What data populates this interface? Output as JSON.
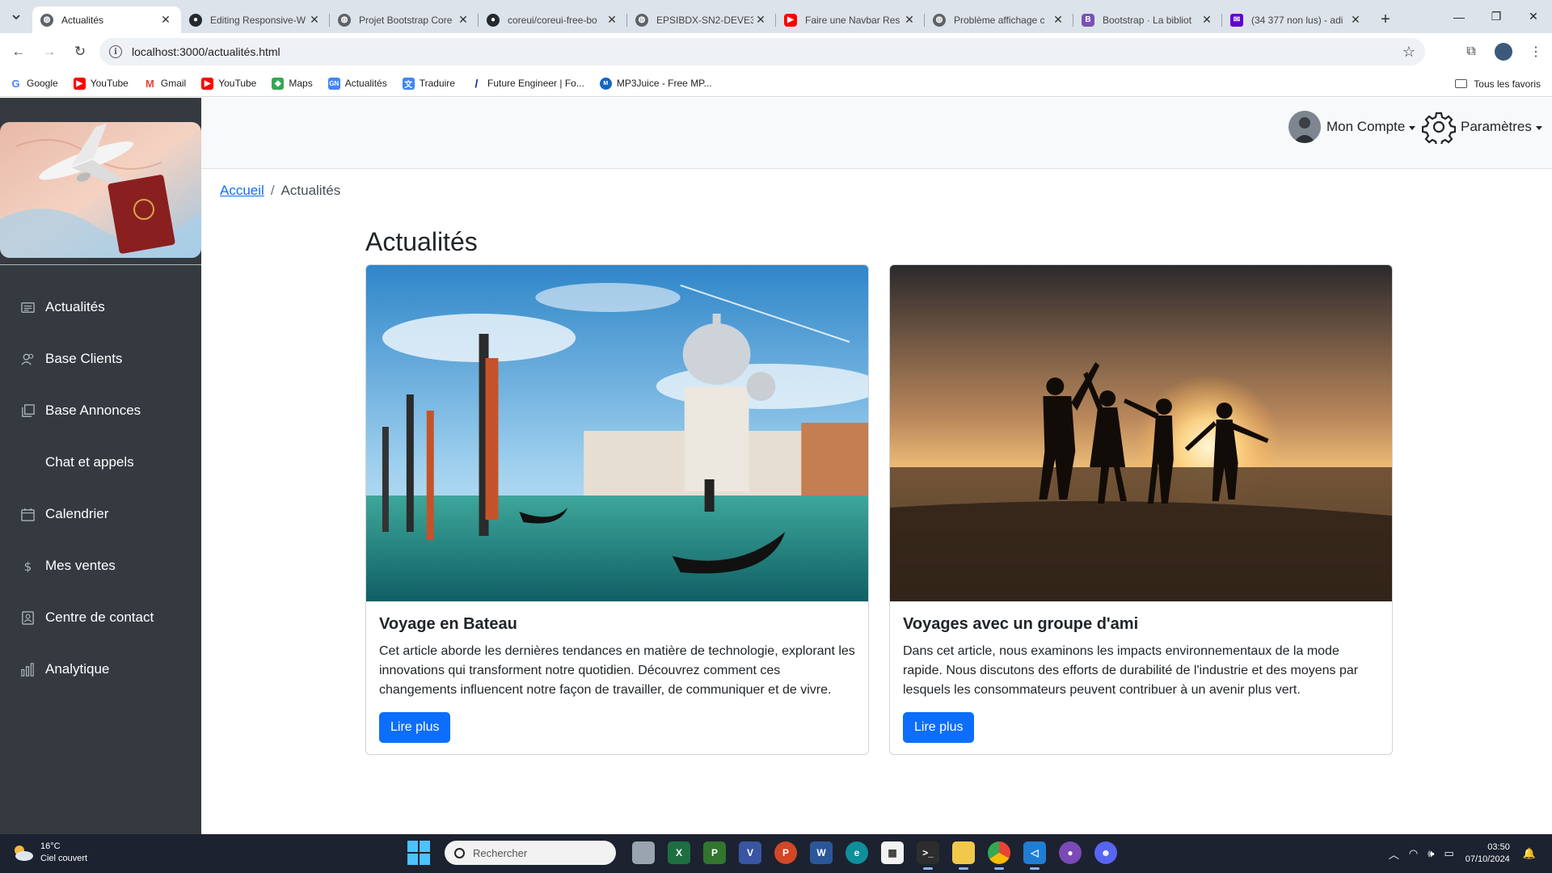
{
  "browser": {
    "tabs": [
      {
        "title": "Actualités",
        "icon": "globe-icon",
        "color": "#5f6368",
        "active": true
      },
      {
        "title": "Editing Responsive-W",
        "icon": "github-icon",
        "color": "#24292f"
      },
      {
        "title": "Projet Bootstrap Core",
        "icon": "globe-icon",
        "color": "#5f6368"
      },
      {
        "title": "coreui/coreui-free-bo",
        "icon": "github-icon",
        "color": "#24292f"
      },
      {
        "title": "EPSIBDX-SN2-DEVE3",
        "icon": "globe-icon",
        "color": "#5f6368"
      },
      {
        "title": "Faire une Navbar Res",
        "icon": "youtube-icon",
        "color": "#ff0000"
      },
      {
        "title": "Problème affichage c",
        "icon": "globe-icon",
        "color": "#5f6368"
      },
      {
        "title": "Bootstrap · La bibliot",
        "icon": "bootstrap-icon",
        "color": "#7952b3"
      },
      {
        "title": "(34 377 non lus) - adi",
        "icon": "mail-icon",
        "color": "#6001d2"
      }
    ],
    "url": "localhost:3000/actualités.html",
    "bookmarks": [
      {
        "label": "Google",
        "icon": "google-icon",
        "color": "#4285f4"
      },
      {
        "label": "YouTube",
        "icon": "youtube-icon",
        "color": "#ff0000"
      },
      {
        "label": "Gmail",
        "icon": "gmail-icon",
        "color": "#ea4335"
      },
      {
        "label": "YouTube",
        "icon": "youtube-icon",
        "color": "#ff0000"
      },
      {
        "label": "Maps",
        "icon": "maps-icon",
        "color": "#34a853"
      },
      {
        "label": "Actualités",
        "icon": "news-icon",
        "color": "#4285f4"
      },
      {
        "label": "Traduire",
        "icon": "translate-icon",
        "color": "#4285f4"
      },
      {
        "label": "Future Engineer | Fo...",
        "icon": "future-engineer-icon",
        "color": "#1a237e"
      },
      {
        "label": "MP3Juice - Free MP...",
        "icon": "mp3juice-icon",
        "color": "#1565c0"
      }
    ],
    "bookmarks_right": "Tous les favoris"
  },
  "sidebar": {
    "items": [
      {
        "label": "Actualités",
        "icon": "newspaper-icon"
      },
      {
        "label": "Base Clients",
        "icon": "people-icon"
      },
      {
        "label": "Base Annonces",
        "icon": "collection-icon"
      },
      {
        "label": "Chat et appels",
        "icon": ""
      },
      {
        "label": "Calendrier",
        "icon": "calendar-icon"
      },
      {
        "label": "Mes ventes",
        "icon": "dollar-icon"
      },
      {
        "label": "Centre de contact",
        "icon": "contact-book-icon"
      },
      {
        "label": "Analytique",
        "icon": "bar-chart-icon"
      }
    ]
  },
  "header": {
    "account_label": "Mon Compte",
    "settings_label": "Paramètres"
  },
  "breadcrumb": {
    "home": "Accueil",
    "separator": "/",
    "current": "Actualités"
  },
  "main": {
    "title": "Actualités",
    "cards": [
      {
        "title": "Voyage en Bateau",
        "text": "Cet article aborde les dernières tendances en matière de technologie, explorant les innovations qui transforment notre quotidien. Découvrez comment ces changements influencent notre façon de travailler, de communiquer et de vivre.",
        "button": "Lire plus"
      },
      {
        "title": "Voyages avec un groupe d'ami",
        "text": "Dans cet article, nous examinons les impacts environnementaux de la mode rapide. Nous discutons des efforts de durabilité de l'industrie et des moyens par lesquels les consommateurs peuvent contribuer à un avenir plus vert.",
        "button": "Lire plus"
      }
    ]
  },
  "taskbar": {
    "weather_temp": "16°C",
    "weather_desc": "Ciel couvert",
    "search_placeholder": "Rechercher",
    "time": "03:50",
    "date": "07/10/2024"
  },
  "colors": {
    "sidebar_bg": "#343a40",
    "primary": "#0d6efd",
    "topbar_bg": "#f8f9fa"
  }
}
